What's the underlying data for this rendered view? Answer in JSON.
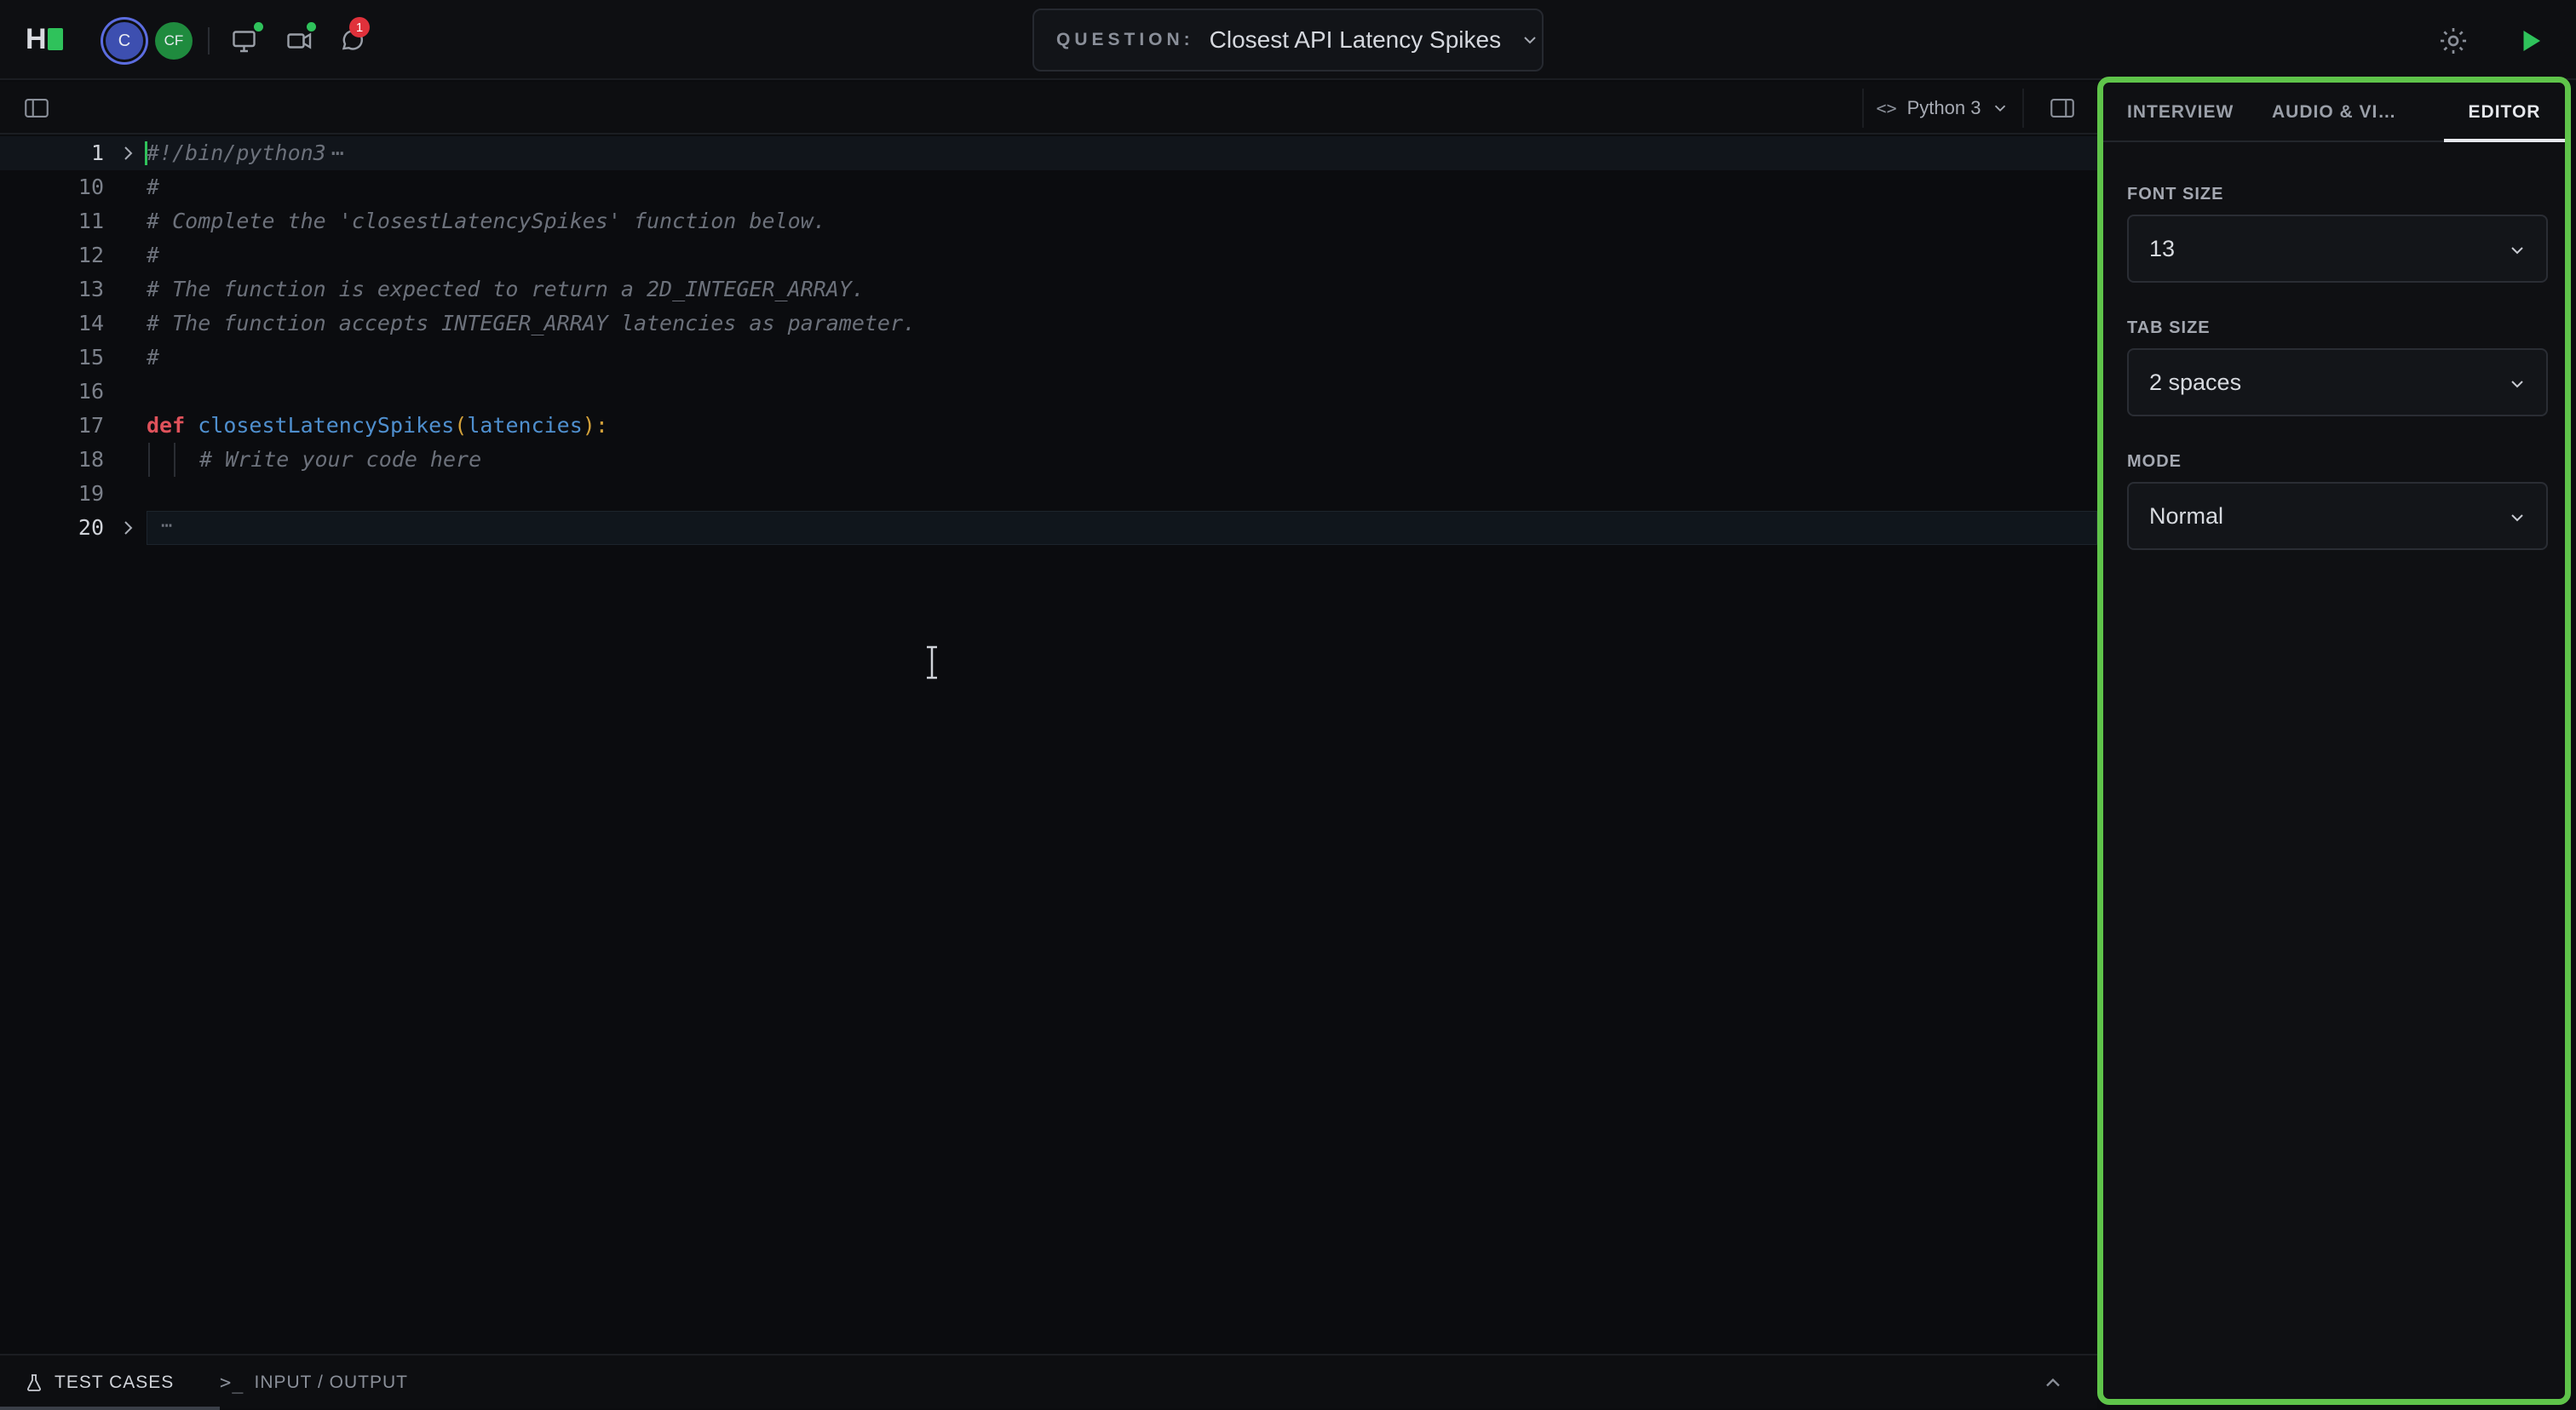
{
  "header": {
    "logo_letter": "H",
    "avatars": [
      "C",
      "CF"
    ],
    "notification_count": "1",
    "question_label": "QUESTION:",
    "question_title": "Closest API Latency Spikes"
  },
  "editor": {
    "language": "Python 3",
    "lines": [
      {
        "num": "1",
        "text": "#!/bin/python3"
      },
      {
        "num": "10",
        "text": "#"
      },
      {
        "num": "11",
        "text": "# Complete the 'closestLatencySpikes' function below."
      },
      {
        "num": "12",
        "text": "#"
      },
      {
        "num": "13",
        "text": "# The function is expected to return a 2D_INTEGER_ARRAY."
      },
      {
        "num": "14",
        "text": "# The function accepts INTEGER_ARRAY latencies as parameter."
      },
      {
        "num": "15",
        "text": "#"
      },
      {
        "num": "16",
        "text": ""
      },
      {
        "num": "17",
        "kw": "def",
        "fn": "closestLatencySpikes",
        "open": "(",
        "param": "latencies",
        "close": ")",
        "colon": ":"
      },
      {
        "num": "18",
        "text": "# Write your code here"
      },
      {
        "num": "19",
        "text": ""
      },
      {
        "num": "20",
        "text": "⋯"
      }
    ],
    "fold_marker": "⋯"
  },
  "bottom": {
    "tabs": [
      "TEST CASES",
      "INPUT / OUTPUT"
    ]
  },
  "right_panel": {
    "tabs": [
      "INTERVIEW",
      "AUDIO & VID…",
      "EDITOR"
    ],
    "active_tab": "EDITOR",
    "font_size_label": "FONT SIZE",
    "font_size_value": "13",
    "tab_size_label": "TAB SIZE",
    "tab_size_value": "2 spaces",
    "mode_label": "MODE",
    "mode_value": "Normal"
  },
  "colors": {
    "accent_green": "#5fc44a",
    "badge_red": "#e0313b",
    "keyword": "#e0525b",
    "function": "#4f8fce",
    "paren": "#d3a13a"
  }
}
